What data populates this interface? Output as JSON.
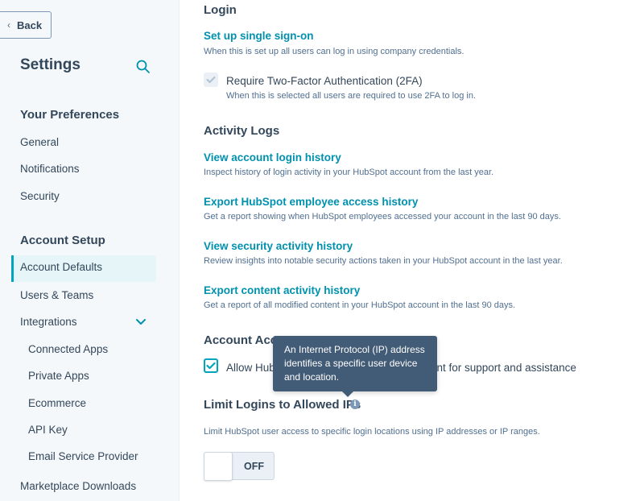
{
  "sidebar": {
    "back_label": "Back",
    "title": "Settings",
    "sections": [
      {
        "heading": "Your Preferences",
        "items": [
          {
            "label": "General"
          },
          {
            "label": "Notifications"
          },
          {
            "label": "Security"
          }
        ]
      },
      {
        "heading": "Account Setup",
        "items": [
          {
            "label": "Account Defaults",
            "active": true
          },
          {
            "label": "Users & Teams"
          },
          {
            "label": "Integrations",
            "expanded": true
          },
          {
            "label": "Connected Apps"
          },
          {
            "label": "Private Apps"
          },
          {
            "label": "Ecommerce"
          },
          {
            "label": "API Key"
          },
          {
            "label": "Email Service Provider"
          },
          {
            "label": "Marketplace Downloads"
          }
        ]
      }
    ]
  },
  "main": {
    "login": {
      "heading": "Login",
      "sso_link": "Set up single sign-on",
      "sso_desc": "When this is set up all users can log in using company credentials.",
      "twofa_label": "Require Two-Factor Authentication (2FA)",
      "twofa_desc": "When this is selected all users are required to use 2FA to log in.",
      "twofa_checked": true,
      "twofa_disabled": true
    },
    "activity": {
      "heading": "Activity Logs",
      "items": [
        {
          "link": "View account login history",
          "desc": "Inspect history of login activity in your HubSpot account from the last year."
        },
        {
          "link": "Export HubSpot employee access history",
          "desc": "Get a report showing when HubSpot employees accessed your account in the last 90 days."
        },
        {
          "link": "View security activity history",
          "desc": "Review insights into notable security actions taken in your HubSpot account in the last year."
        },
        {
          "link": "Export content activity history",
          "desc": "Get a report of all modified content in your HubSpot account in the last 90 days."
        }
      ]
    },
    "account_access": {
      "heading_visible": "Account Acce",
      "allow_label_left": "Allow Hub",
      "allow_label_right": "unt for support and assistance",
      "allow_checked": true
    },
    "limit_ips": {
      "heading": "Limit Logins to Allowed IPs",
      "desc": "Limit HubSpot user access to specific login locations using IP addresses or IP ranges.",
      "toggle_label": "OFF",
      "toggle_on": false
    },
    "tooltip": {
      "text": "An Internet Protocol (IP) address identifies a specific user device and location."
    }
  },
  "colors": {
    "accent": "#00a4bd",
    "link": "#0091ae",
    "text": "#33475b",
    "muted": "#516f90",
    "tooltip_bg": "#425b76",
    "sidebar_bg": "#f5f8fa",
    "active_bg": "#e5f5f8"
  }
}
